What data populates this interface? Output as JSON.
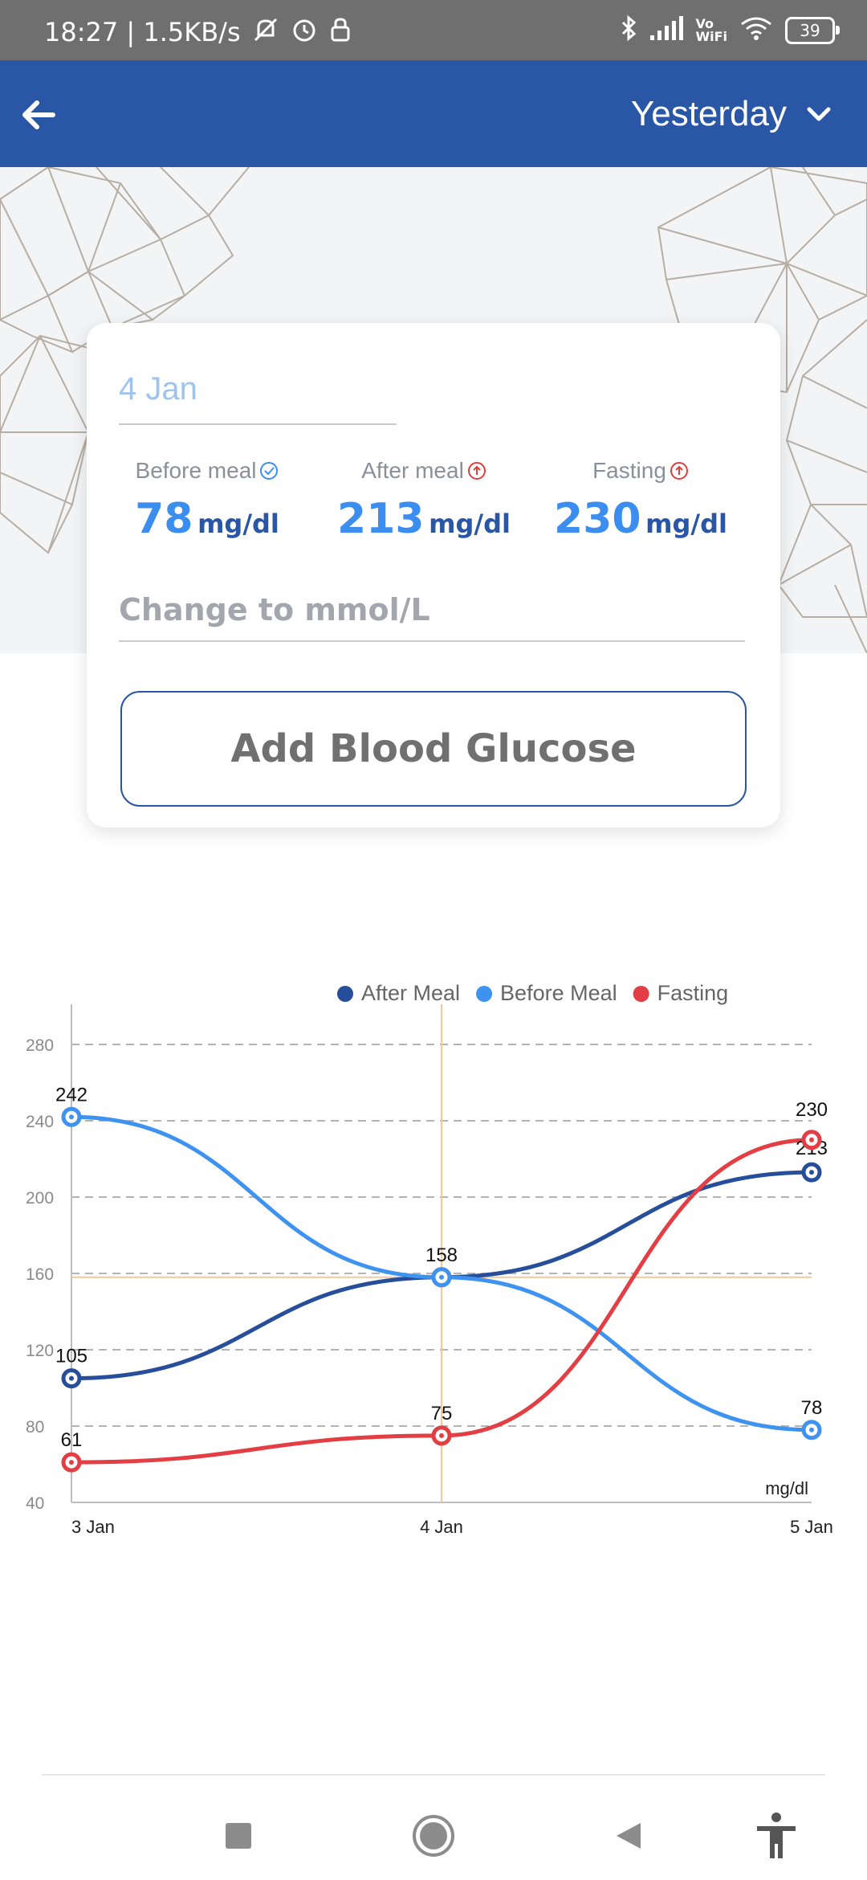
{
  "status_bar": {
    "left_text": "18:27 | 1.5KB/s",
    "battery": "39",
    "icons": [
      "mute-icon",
      "alarm-icon",
      "lock-icon",
      "bluetooth-icon",
      "signal-icon",
      "vowifi-icon",
      "wifi-icon",
      "battery-icon"
    ],
    "vowifi_top": "Vo",
    "vowifi_bottom": "WiFi"
  },
  "app_bar": {
    "back_icon": "arrow-left-icon",
    "range_label": "Yesterday",
    "range_icon": "chevron-down-icon",
    "color": "#2a56a6"
  },
  "card": {
    "date_value": "4 Jan",
    "metrics": [
      {
        "label": "Before meal",
        "value": "78",
        "unit": "mg/dl",
        "status": "check-circle-icon",
        "status_color": "#3b8ef0"
      },
      {
        "label": "After meal",
        "value": "213",
        "unit": "mg/dl",
        "status": "arrow-up-circle-icon",
        "status_color": "#e23d3d"
      },
      {
        "label": "Fasting",
        "value": "230",
        "unit": "mg/dl",
        "status": "arrow-up-circle-icon",
        "status_color": "#e23d3d"
      }
    ],
    "change_unit_label": "Change to mmol/L",
    "add_button_label": "Add Blood Glucose"
  },
  "chart_data": {
    "type": "line",
    "categories": [
      "3 Jan",
      "4 Jan",
      "5 Jan"
    ],
    "series": [
      {
        "name": "After Meal",
        "values": [
          105,
          158,
          213
        ],
        "color": "#264e9a"
      },
      {
        "name": "Before Meal",
        "values": [
          242,
          158,
          78
        ],
        "color": "#3f93f0"
      },
      {
        "name": "Fasting",
        "values": [
          61,
          75,
          230
        ],
        "color": "#e33e44"
      }
    ],
    "y_ticks": [
      "280",
      "240",
      "200",
      "160",
      "120",
      "80",
      "40"
    ],
    "ylim": [
      40,
      280
    ],
    "unit_label": "mg/dl",
    "legend_position": "top-right",
    "grid": true,
    "highlight_category": "4 Jan",
    "highlight_value": 158,
    "highlight_color": "#f5c79a"
  },
  "nav_bar": {
    "icons": [
      "square-icon",
      "home-circle-icon",
      "back-triangle-icon",
      "accessibility-icon"
    ]
  }
}
